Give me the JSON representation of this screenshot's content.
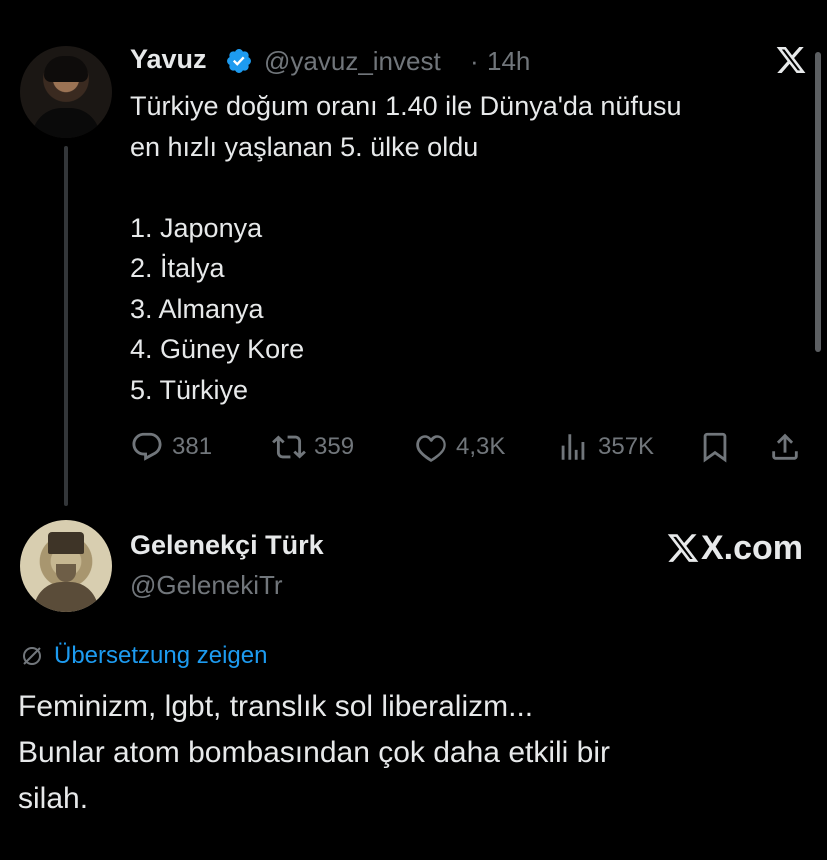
{
  "tweet": {
    "author_name": "Yavuz",
    "verified": true,
    "handle": "@yavuz_invest",
    "separator": "·",
    "time": "14h",
    "text_lines": [
      "Türkiye doğum oranı 1.40 ile Dünya'da nüfusu",
      "en hızlı yaşlanan 5. ülke oldu",
      "",
      "1. Japonya",
      "2. İtalya",
      "3. Almanya",
      "4. Güney Kore",
      "5. Türkiye"
    ],
    "actions": {
      "replies": "381",
      "reposts": "359",
      "likes": "4,3K",
      "views": "357K"
    },
    "brand_logo": "x-logo-icon"
  },
  "quote": {
    "author_name": "Gelenekçi Türk",
    "handle": "@GelenekiTr",
    "watermark": "X.com",
    "translate_label": "Übersetzung zeigen",
    "text_lines": [
      "Feminizm, lgbt, translık sol liberalizm...",
      "Bunlar atom bombasından çok daha etkili bir",
      "silah."
    ]
  },
  "colors": {
    "background": "#000000",
    "text": "#e7e9ea",
    "muted": "#71767b",
    "accent": "#1d9bf0"
  }
}
